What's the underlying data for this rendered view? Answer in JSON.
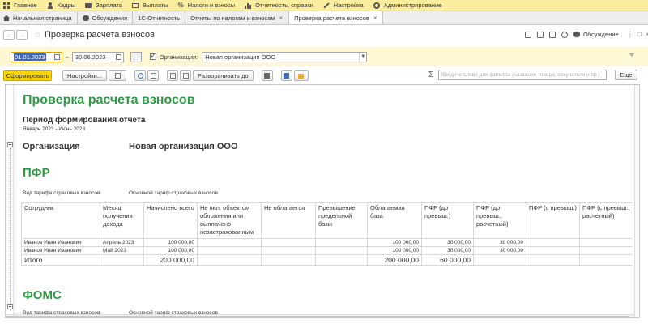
{
  "top_menu": {
    "items": [
      {
        "label": "Главное",
        "icon": "grid-icon"
      },
      {
        "label": "Кадры",
        "icon": "person-icon"
      },
      {
        "label": "Зарплата",
        "icon": "wallet-icon"
      },
      {
        "label": "Выплаты",
        "icon": "cash-icon"
      },
      {
        "label": "Налоги и взносы",
        "icon": "percent-icon"
      },
      {
        "label": "Отчетность, справки",
        "icon": "chart-icon"
      },
      {
        "label": "Настройка",
        "icon": "wrench-icon"
      },
      {
        "label": "Администрирование",
        "icon": "gear-icon"
      }
    ]
  },
  "tabs": {
    "home": "Начальная страница",
    "discussions": "Обсуждения",
    "reporting": "1С-Отчетность",
    "tax_reports": "Отчеты по налогам и взносам",
    "active": "Проверка расчета взносов",
    "close": "×"
  },
  "title_bar": {
    "title": "Проверка расчета взносов",
    "discussion": "Обсуждение",
    "back": "←",
    "forward": "→",
    "star": "☆",
    "more": "⋮",
    "maximize": "□",
    "close": "×"
  },
  "filter": {
    "date_from": "01.01.2023",
    "date_to": "30.06.2023",
    "dash": "–",
    "org_label": "Организация:",
    "org_value": "Новая организация ООО",
    "dots": "..."
  },
  "toolbar": {
    "generate": "Сформировать",
    "settings": "Настройки...",
    "expand": "Разворачивать до",
    "sigma": "Σ",
    "search_placeholder": "Введите слово для фильтра (название товара, покупателя и пр.)",
    "more": "Еще"
  },
  "report": {
    "title": "Проверка расчета взносов",
    "period_label": "Период формирования отчета",
    "period": "Январь 2023 - Июнь 2023",
    "org_label": "Организация",
    "org_name": "Новая организация ООО",
    "pfr_section": "ПФР",
    "tariff_label": "Вид тарифа страховых взносов",
    "tariff_value": "Основной тариф страховых взносов",
    "foms_section": "ФОМС",
    "columns": [
      "Сотрудник",
      "Месяц получения дохода",
      "Начислено всего",
      "Не явл. объектом обложения или выплачено незастрахованным",
      "Не облагается",
      "Превышение предельной базы",
      "Облагаемая база",
      "ПФР (до превыш.)",
      "ПФР (до превыш., расчетный)",
      "ПФР (с превыш.)",
      "ПФР (с превыш., расчетный)"
    ],
    "rows": [
      {
        "employee": "Иванов Иван Иванович",
        "month": "Апрель 2023",
        "accrued": "100 000,00",
        "base": "100 000,00",
        "pfr": "30 000,00",
        "pfr_calc": "30 000,00"
      },
      {
        "employee": "Иванов Иван Иванович",
        "month": "Май 2023",
        "accrued": "100 000,00",
        "base": "100 000,00",
        "pfr": "30 000,00",
        "pfr_calc": "30 000,00"
      }
    ],
    "total": {
      "label": "Итого",
      "accrued": "200 000,00",
      "base": "200 000,00",
      "pfr": "60 000,00"
    }
  }
}
